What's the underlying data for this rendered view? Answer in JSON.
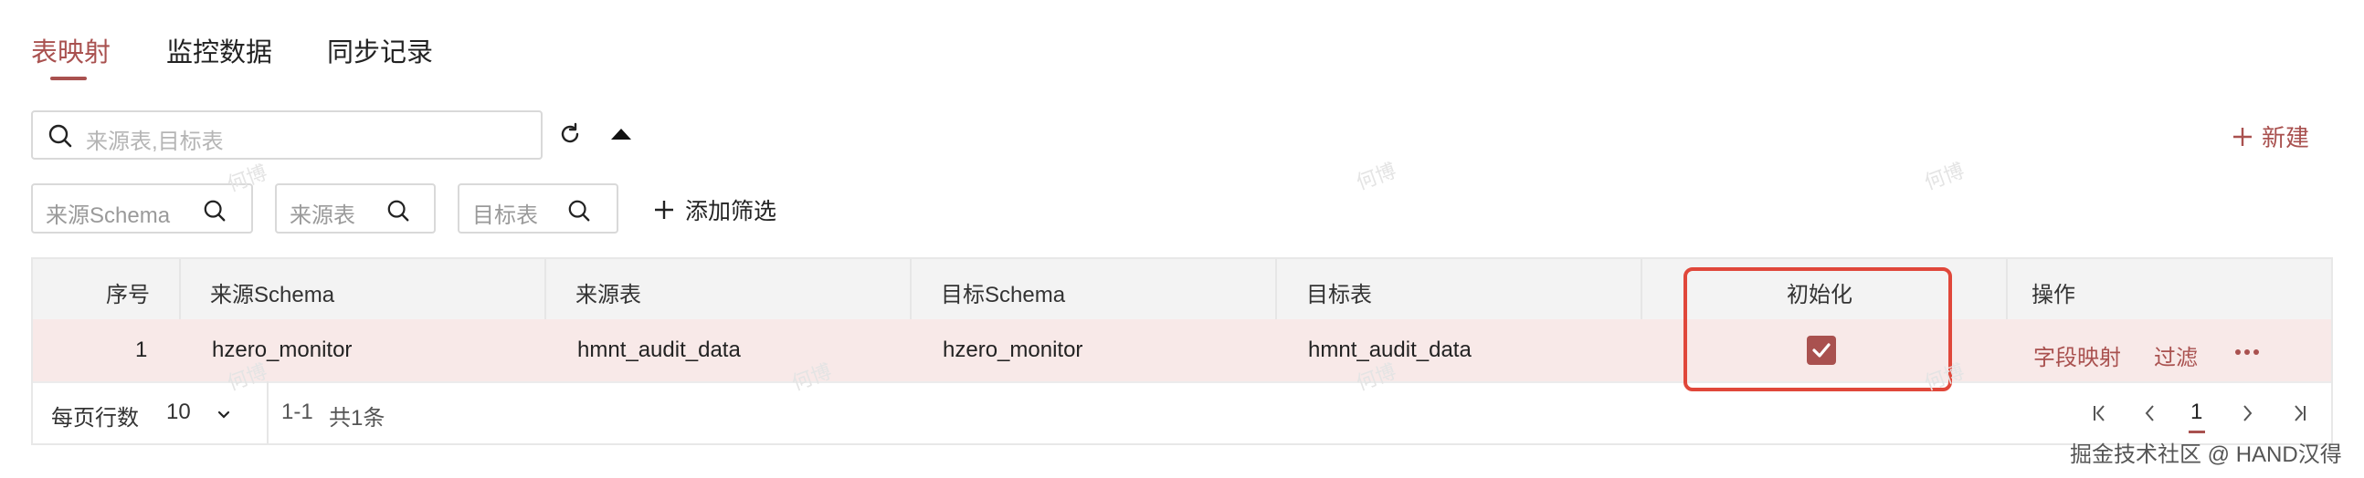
{
  "tabs": [
    {
      "label": "表映射",
      "active": true
    },
    {
      "label": "监控数据",
      "active": false
    },
    {
      "label": "同步记录",
      "active": false
    }
  ],
  "search": {
    "placeholder": "来源表,目标表"
  },
  "new_button": "新建",
  "filters": [
    {
      "placeholder": "来源Schema"
    },
    {
      "placeholder": "来源表"
    },
    {
      "placeholder": "目标表"
    }
  ],
  "add_filter": "添加筛选",
  "table": {
    "columns": [
      "序号",
      "来源Schema",
      "来源表",
      "目标Schema",
      "目标表",
      "初始化",
      "操作"
    ],
    "rows": [
      {
        "index": "1",
        "source_schema": "hzero_monitor",
        "source_table": "hmnt_audit_data",
        "target_schema": "hzero_monitor",
        "target_table": "hmnt_audit_data",
        "initialized": true,
        "actions": [
          "字段映射",
          "过滤"
        ]
      }
    ]
  },
  "pagination": {
    "rows_per_page_label": "每页行数",
    "rows_per_page": "10",
    "range": "1-1",
    "total": "共1条",
    "current_page": "1"
  },
  "watermark": "何博",
  "credit": "掘金技术社区 @ HAND汉得",
  "colors": {
    "accent": "#a9514f",
    "highlight": "#e0473a",
    "row_bg": "#f8e9e8",
    "header_bg": "#f3f3f3"
  }
}
